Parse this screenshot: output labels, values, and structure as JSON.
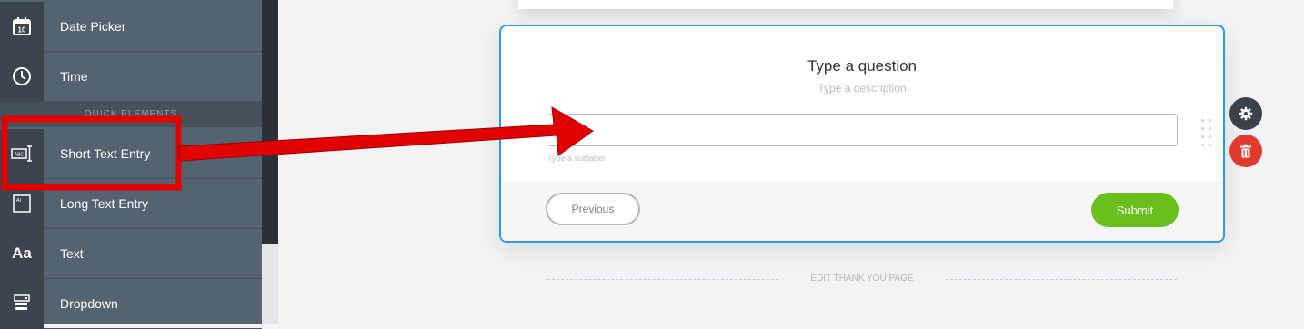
{
  "sidebar": {
    "items": [
      {
        "label": "Date Picker",
        "icon": "calendar-icon"
      },
      {
        "label": "Time",
        "icon": "clock-icon"
      },
      {
        "label": "Short Text Entry",
        "icon": "short-text-icon"
      },
      {
        "label": "Long Text Entry",
        "icon": "long-text-icon"
      },
      {
        "label": "Text",
        "icon": "text-aa-icon"
      },
      {
        "label": "Dropdown",
        "icon": "dropdown-icon"
      }
    ],
    "section_label": "QUICK ELEMENTS",
    "calendar_day": "10",
    "text_icon_glyph": "Aa",
    "abc_glyph": "ABC",
    "ai_glyph": "AI"
  },
  "question": {
    "title": "Type a question",
    "description": "Type a description",
    "input_value": "",
    "sublabel": "Type a sublabel"
  },
  "footer": {
    "previous_label": "Previous",
    "submit_label": "Submit"
  },
  "thank_you": {
    "label": "EDIT THANK YOU PAGE"
  },
  "colors": {
    "accent_border": "#2f9ae0",
    "submit": "#6bbf1c",
    "delete": "#e23a2e",
    "annotation": "#e00000"
  }
}
